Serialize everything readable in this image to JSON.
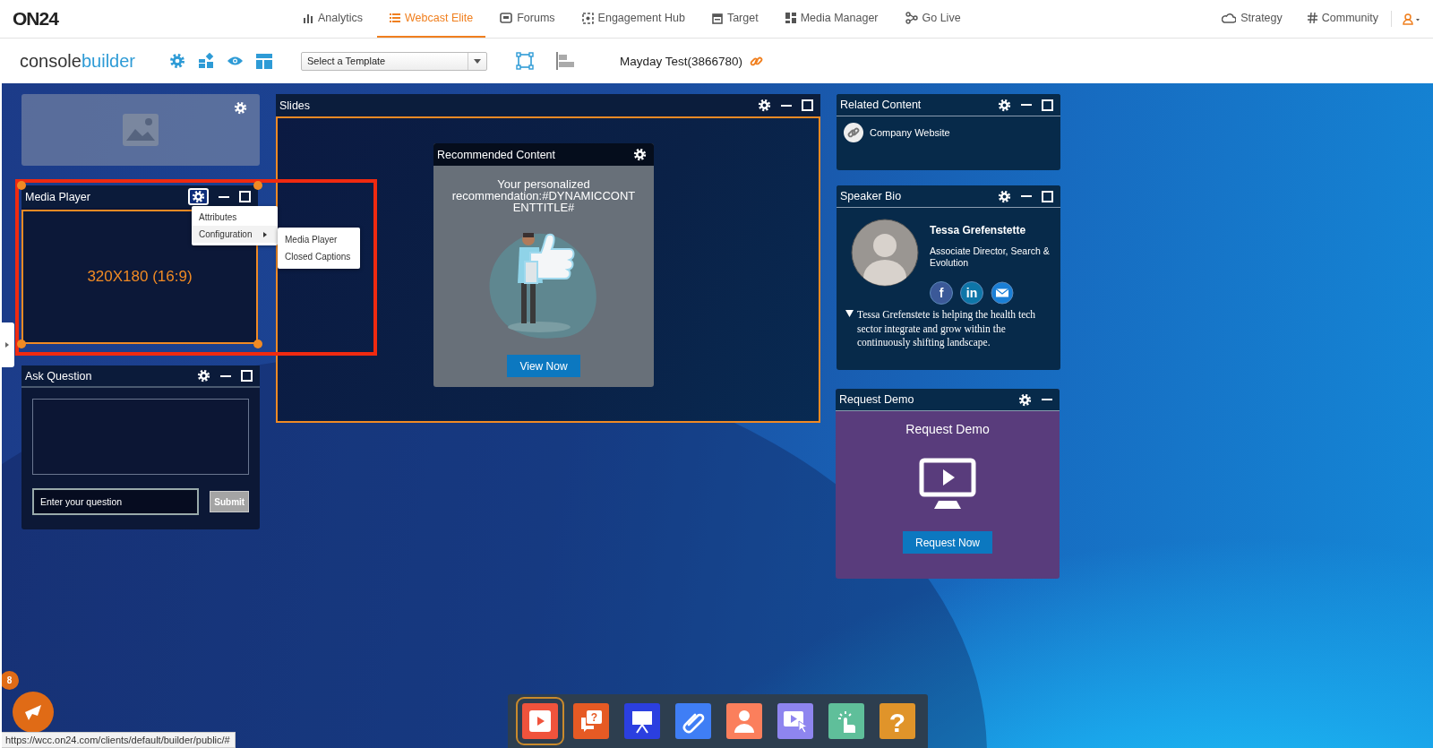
{
  "nav": {
    "logo": "ON24",
    "items": [
      {
        "label": "Analytics",
        "kind": "analytics",
        "selected": false
      },
      {
        "label": "Webcast Elite",
        "kind": "list",
        "selected": true
      },
      {
        "label": "Forums",
        "kind": "forum",
        "selected": false
      },
      {
        "label": "Engagement Hub",
        "kind": "hub",
        "selected": false
      },
      {
        "label": "Target",
        "kind": "target",
        "selected": false
      },
      {
        "label": "Media Manager",
        "kind": "media",
        "selected": false
      },
      {
        "label": "Go Live",
        "kind": "golive",
        "selected": false
      }
    ],
    "right": [
      {
        "label": "Strategy",
        "kind": "cloud"
      },
      {
        "label": "Community",
        "kind": "hash"
      }
    ]
  },
  "toolbar": {
    "brand": [
      "console",
      "builder"
    ],
    "template_select": {
      "value": "Select a Template"
    },
    "event_title": "Mayday Test(3866780)"
  },
  "widgets": [
    {
      "kind": "image"
    },
    {
      "kind": "media_player",
      "title": "Media Player",
      "minimize_button": true,
      "maximize_button": true,
      "settings_active": true,
      "size_label": "320X180 (16:9)",
      "menu": [
        {
          "label": "Attributes",
          "selected": false,
          "submenu": false
        },
        {
          "label": "Configuration",
          "selected": true,
          "submenu": true
        }
      ],
      "submenu": [
        "Media Player",
        "Closed Captions"
      ]
    },
    {
      "kind": "ask_question",
      "title": "Ask Question",
      "minimize_button": true,
      "maximize_button": true,
      "input": {
        "placeholder": "Enter your question"
      },
      "submit": {
        "label": "Submit",
        "disabled": true
      }
    },
    {
      "kind": "slides",
      "title": "Slides",
      "minimize_button": true,
      "maximize_button": true,
      "recommended": {
        "title": "Recommended Content",
        "message": "Your personalized recommendation:#DYNAMICCONTENTTITLE#",
        "button": "View Now"
      }
    },
    {
      "kind": "related_content",
      "title": "Related Content",
      "minimize_button": true,
      "maximize_button": true,
      "links": [
        {
          "label": "Company Website"
        }
      ]
    },
    {
      "kind": "speaker_bio",
      "title": "Speaker Bio",
      "minimize_button": true,
      "maximize_button": true,
      "name": "Tessa Grefenstette",
      "role": "Associate Director, Search & Evolution",
      "socials": [
        {
          "kind": "facebook",
          "glyph": "f",
          "color": "#3b5998"
        },
        {
          "kind": "linkedin",
          "glyph": "in",
          "color": "#0e76a8"
        },
        {
          "kind": "email",
          "color": "#1a7fd6"
        }
      ],
      "expanded": true,
      "bio": "Tessa Grefenstete is helping the health tech sector integrate and grow within the continuously shifting landscape."
    },
    {
      "kind": "request_demo",
      "title": "Request Demo",
      "minimize_button": true,
      "maximize_button": false,
      "heading": "Request Demo",
      "button": "Request Now"
    }
  ],
  "dock": [
    {
      "kind": "media",
      "color": "#f0533c",
      "selected": true
    },
    {
      "kind": "qa",
      "color": "#e65a24",
      "glyph": "?",
      "selected": false
    },
    {
      "kind": "slides",
      "color": "#2b3fe0",
      "selected": false
    },
    {
      "kind": "resources",
      "color": "#3f7ef5",
      "selected": false
    },
    {
      "kind": "speaker",
      "color": "#fb7f5c",
      "selected": false
    },
    {
      "kind": "video",
      "color": "#8e85ef",
      "selected": false
    },
    {
      "kind": "engage",
      "color": "#5fbf9a",
      "selected": false
    },
    {
      "kind": "help",
      "color": "#e0942a",
      "glyph": "?",
      "selected": false
    }
  ],
  "notification": {
    "count": "8"
  },
  "status_url": "https://wcc.on24.com/clients/default/builder/public/#"
}
